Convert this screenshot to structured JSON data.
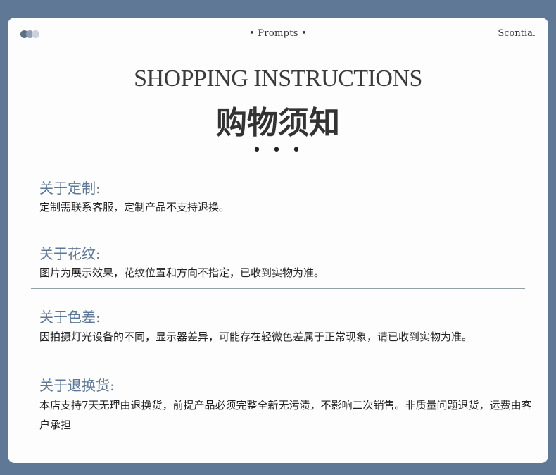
{
  "header": {
    "center_label": "• Prompts •",
    "brand": "Scontia.",
    "dot_colors": [
      "#5d6f86",
      "#8d9eb3",
      "#c9d2dd"
    ]
  },
  "title": {
    "english": "SHOPPING INSTRUCTIONS",
    "chinese": "购物须知",
    "ellipsis": "• • •"
  },
  "sections": [
    {
      "heading": "关于定制:",
      "text": "定制需联系客服，定制产品不支持退换。"
    },
    {
      "heading": "关于花纹:",
      "text": "图片为展示效果，花纹位置和方向不指定，已收到实物为准。"
    },
    {
      "heading": "关于色差:",
      "text": "因拍摄灯光设备的不同，显示器差异，可能存在轻微色差属于正常现象，请已收到实物为准。"
    },
    {
      "heading": "关于退换货:",
      "text": "本店支持7天无理由退换货，前提产品必须完整全新无污渍，不影响二次销售。非质量问题退货，运费由客户承担"
    }
  ],
  "colors": {
    "page_background": "#5f7896",
    "card_background": "#fdfdfd",
    "heading_accent": "#5d7896",
    "divider": "#8fa3a6"
  }
}
